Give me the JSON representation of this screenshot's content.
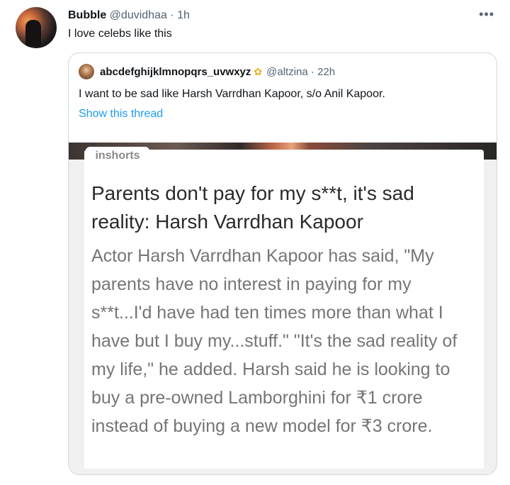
{
  "tweet": {
    "name": "Bubble",
    "handle": "@duvidhaa",
    "separator": "·",
    "time": "1h",
    "more_label": "•••",
    "text": "I love celebs like this"
  },
  "quote": {
    "name": "abcdefghijklmnopqrs_uvwxyz",
    "emoji_icon": "flower-icon",
    "emoji": "✿",
    "handle": "@altzina",
    "separator": "·",
    "time": "22h",
    "text": "I want to be sad like Harsh Varrdhan Kapoor, s/o Anil Kapoor.",
    "show_thread": "Show this thread"
  },
  "media": {
    "brand": "inshorts",
    "headline": "Parents don't pay for my s**t, it's sad reality: Harsh Varrdhan Kapoor",
    "body": "Actor Harsh Varrdhan Kapoor has said, \"My parents have no interest in paying for my s**t...I'd have had ten times more than what I have but I buy my...stuff.\" \"It's the sad reality of my life,\" he added. Harsh said he is looking to buy a pre-owned Lamborghini for ₹1 crore instead of buying a new model for ₹3 crore."
  },
  "colors": {
    "link": "#1d9bf0",
    "secondary": "#536471",
    "border": "#cfd9de"
  }
}
